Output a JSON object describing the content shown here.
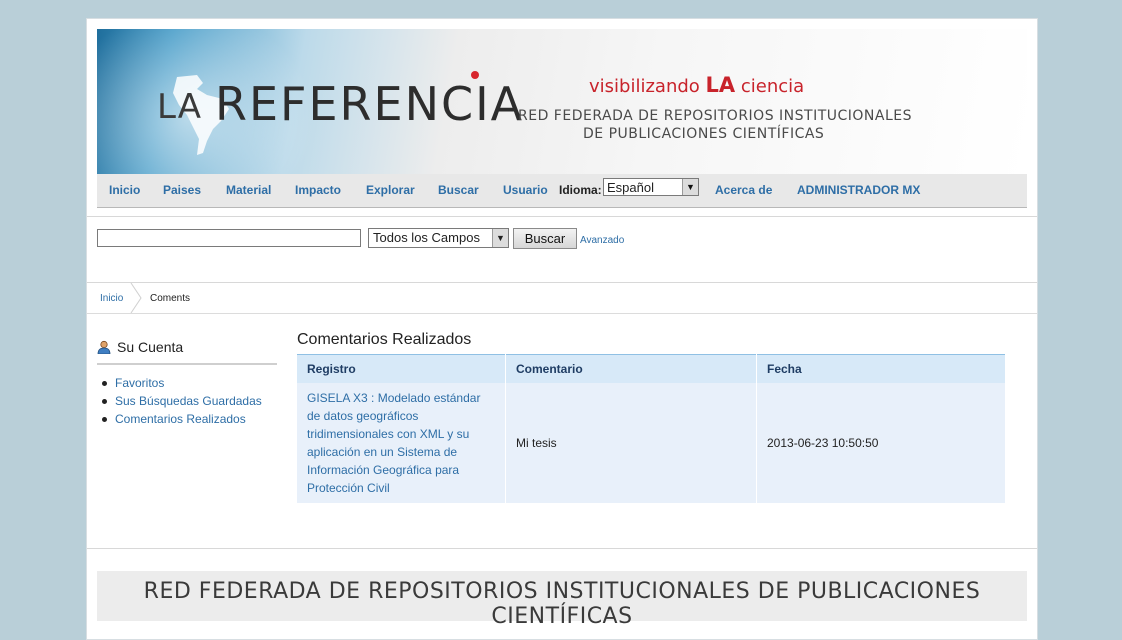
{
  "banner": {
    "logo_la": "LA",
    "logo_referencia": "REFERENCIA",
    "tagline_pre": "visibilizando ",
    "tagline_la": "LA",
    "tagline_post": " ciencia",
    "subtitle_line1": "RED FEDERADA DE REPOSITORIOS INSTITUCIONALES",
    "subtitle_line2": "DE PUBLICACIONES CIENTÍFICAS"
  },
  "nav": {
    "items": [
      "Inicio",
      "Paises",
      "Material",
      "Impacto",
      "Explorar",
      "Buscar",
      "Usuario"
    ],
    "idioma_label": "Idioma:",
    "idioma_value": "Español",
    "about": "Acerca de",
    "admin": "ADMINISTRADOR MX"
  },
  "search": {
    "query": "",
    "field_value": "Todos los Campos",
    "button": "Buscar",
    "advanced": "Avanzado"
  },
  "breadcrumb": {
    "home": "Inicio",
    "current": "Coments"
  },
  "sidebar": {
    "title": "Su Cuenta",
    "items": [
      "Favoritos",
      "Sus Búsquedas Guardadas",
      "Comentarios Realizados"
    ]
  },
  "main": {
    "title": "Comentarios Realizados",
    "columns": [
      "Registro",
      "Comentario",
      "Fecha"
    ],
    "rows": [
      {
        "registro": "GISELA X3 : Modelado estándar de datos geográficos tridimensionales con XML y su aplicación en un Sistema de Información Geográfica para Protección Civil",
        "comentario": "Mi tesis",
        "fecha": "2013-06-23 10:50:50"
      }
    ]
  },
  "footer": {
    "text": "RED FEDERADA DE REPOSITORIOS INSTITUCIONALES DE PUBLICACIONES CIENTÍFICAS"
  },
  "colors": {
    "link": "#2e6ea6",
    "accent_red": "#c8232b",
    "page_bg": "#b9cfd8"
  }
}
